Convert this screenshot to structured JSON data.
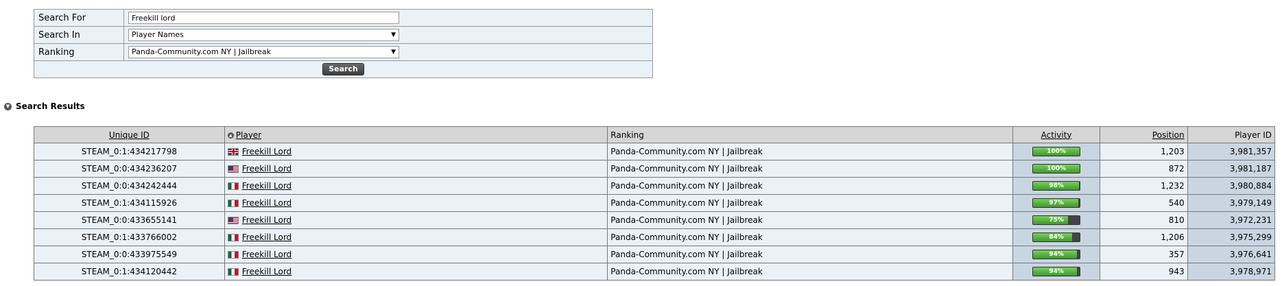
{
  "search_form": {
    "search_for_label": "Search For",
    "search_for_value": "Freekill lord",
    "search_in_label": "Search In",
    "search_in_value": "Player Names",
    "ranking_label": "Ranking",
    "ranking_value": "Panda-Community.com NY | Jailbreak",
    "search_button": "Search"
  },
  "results": {
    "section_title": "Search Results",
    "columns": {
      "unique_id": "Unique ID",
      "player": "Player",
      "ranking": "Ranking",
      "activity": "Activity",
      "position": "Position",
      "player_id": "Player ID"
    },
    "rows": [
      {
        "unique_id": "STEAM_0:1:434217798",
        "flag": "gb-flag-icon",
        "player": "Freekill Lord",
        "ranking": "Panda-Community.com NY | Jailbreak",
        "activity": "100%",
        "activity_value": 100,
        "position": "1,203",
        "player_id": "3,981,357"
      },
      {
        "unique_id": "STEAM_0:0:434236207",
        "flag": "us-flag-icon",
        "player": "Freekill Lord",
        "ranking": "Panda-Community.com NY | Jailbreak",
        "activity": "100%",
        "activity_value": 100,
        "position": "872",
        "player_id": "3,981,187"
      },
      {
        "unique_id": "STEAM_0:0:434242444",
        "flag": "mx-flag-icon",
        "player": "Freekill Lord",
        "ranking": "Panda-Community.com NY | Jailbreak",
        "activity": "98%",
        "activity_value": 98,
        "position": "1,232",
        "player_id": "3,980,884"
      },
      {
        "unique_id": "STEAM_0:1:434115926",
        "flag": "mx-flag-icon",
        "player": "Freekill Lord",
        "ranking": "Panda-Community.com NY | Jailbreak",
        "activity": "97%",
        "activity_value": 97,
        "position": "540",
        "player_id": "3,979,149"
      },
      {
        "unique_id": "STEAM_0:0:433655141",
        "flag": "us-flag-icon",
        "player": "Freekill Lord",
        "ranking": "Panda-Community.com NY | Jailbreak",
        "activity": "75%",
        "activity_value": 75,
        "position": "810",
        "player_id": "3,972,231"
      },
      {
        "unique_id": "STEAM_0:1:433766002",
        "flag": "mx-flag-icon",
        "player": "Freekill Lord",
        "ranking": "Panda-Community.com NY | Jailbreak",
        "activity": "84%",
        "activity_value": 84,
        "position": "1,206",
        "player_id": "3,975,299"
      },
      {
        "unique_id": "STEAM_0:0:433975549",
        "flag": "mx-flag-icon",
        "player": "Freekill Lord",
        "ranking": "Panda-Community.com NY | Jailbreak",
        "activity": "94%",
        "activity_value": 94,
        "position": "357",
        "player_id": "3,976,641"
      },
      {
        "unique_id": "STEAM_0:1:434120442",
        "flag": "mx-flag-icon",
        "player": "Freekill Lord",
        "ranking": "Panda-Community.com NY | Jailbreak",
        "activity": "94%",
        "activity_value": 94,
        "position": "943",
        "player_id": "3,978,971"
      }
    ]
  },
  "colors": {
    "row_background": "#eaf1f7",
    "sorted_column_background": "#c9d6e2",
    "header_background": "#d6d6d6",
    "activity_bar_fill": "#4fae38"
  }
}
